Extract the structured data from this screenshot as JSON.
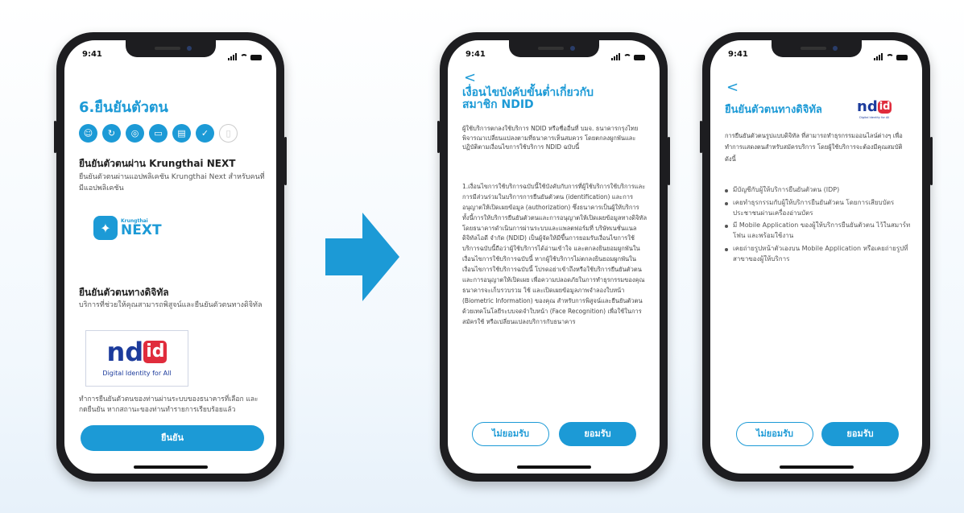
{
  "phone1": {
    "time": "9:41",
    "title": "6.ยืนยันตัวตน",
    "step_icons": [
      "user-icon",
      "refresh-icon",
      "fingerprint-icon",
      "card-icon",
      "document-icon",
      "document-check-icon",
      "document-outline-icon"
    ],
    "section1_heading": "ยืนยันตัวตนผ่าน Krungthai NEXT",
    "section1_desc": "ยืนยันตัวตนผ่านแอปพลิเคชัน Krungthai Next สำหรับคนที่มีแอปพลิเคชัน",
    "next_logo_small": "Krungthai",
    "next_logo_big": "NEXT",
    "section2_heading": "ยืนยันตัวตนทางดิจิทัล",
    "section2_desc": "บริการที่ช่วยให้คุณสามารถพิสูจน์และยืนยันตัวตนทางดิจิทัล",
    "ndid_word_left": "nd",
    "ndid_word_right": "id",
    "ndid_tagline": "Digital Identity for All",
    "footer_text": "ทำการยืนยันตัวตนของท่านผ่านระบบของธนาคารที่เลือก และกดยืนยัน หากสถานะของท่านทำรายการเรียบร้อยแล้ว",
    "confirm_button": "ยืนยัน"
  },
  "arrow_color": "#1c9ad6",
  "phone2": {
    "time": "9:41",
    "back": "<",
    "title": "เงื่อนไขบังคับขั้นต่ำเกี่ยวกับสมาชิก NDID",
    "intro": "ผู้ใช้บริการตกลงใช้บริการ NDID หรือชื่ออื่นที่ บมจ. ธนาคารกรุงไทย พิจารณาเปลี่ยนแปลงตามที่ธนาคารเห็นสมควร โดยตกลงผูกพันและปฏิบัติตามเงื่อนไขการใช้บริการ NDID ฉบับนี้",
    "body": "1.เงื่อนไขการใช้บริการฉบับนี้ใช้บังคับกับการที่ผู้ใช้บริการใช้บริการและการมีส่วนร่วมในบริการการยืนยันตัวตน (identification) และการอนุญาตให้เปิดเผยข้อมูล (authorization) ซึ่งธนาคารเป็นผู้ให้บริการ ทั้งนี้การให้บริการยืนยันตัวตนและการอนุญาตให้เปิดเผยข้อมูลทางดิจิทัล โดยธนาคารดำเนินการผ่านระบบและแพลตฟอร์มที่ บริษัทเนชั่นแนลดิจิทัลไอดี จำกัด (NDID) เป็นผู้จัดให้มีขึ้นการยอมรับเงื่อนไขการใช้บริการฉบับนี้ถือว่าผู้ใช้บริการได้อ่านเข้าใจ และตกลงยินยอมผูกพันในเงื่อนไขการใช้บริการฉบับนี้ หากผู้ใช้บริการไม่ตกลงยินยอมผูกพันในเงื่อนไขการใช้บริการฉบับนี้ โปรดอย่าเข้าถึงหรือใช้บริการยืนยันตัวตนและการอนุญาตให้เปิดเผย เพื่อความปลอดภัยในการทำธุรกรรมของคุณธนาคารจะเก็บรวบรวม ใช้ และเปิดเผยข้อมูลภาพจำลองใบหน้า (Biometric Information) ของคุณ สำหรับการพิสูจน์และยืนยันตัวตนด้วยเทคโนโลยีระบบจดจำใบหน้า (Face Recognition) เพื่อใช้ในการสมัครใช้ หรือเปลี่ยนแปลงบริการกับธนาคาร",
    "decline_button": "ไม่ยอมรับ",
    "accept_button": "ยอมรับ"
  },
  "phone3": {
    "time": "9:41",
    "back": "<",
    "title": "ยืนยันตัวตนทางดิจิทัล",
    "ndid_word_left": "nd",
    "ndid_word_right": "id",
    "ndid_tagline": "Digital Identity for All",
    "intro": "การยืนยันตัวตนรูปแบบดิจิทัล ที่สามารถทำธุรกรรมออนไลน์ต่างๆ เพื่อทำการแสดงตนสำหรับสมัครบริการ โดยผู้ใช้บริการจะต้องมีคุณสมบัติดังนี้",
    "bullets": [
      "มีบัญชีกับผู้ให้บริการยืนยันตัวตน (IDP)",
      "เคยทำธุรกรรมกับผู้ให้บริการยืนยันตัวตน โดยการเสียบบัตรประชาชนผ่านเครื่องอ่านบัตร",
      "มี Mobile Application ของผู้ให้บริการยืนยันตัวตน ไว้ในสมาร์ทโฟน และพร้อมใช้งาน",
      "เคยถ่ายรูปหน้าตัวเองบน Mobile Application หรือเคยถ่ายรูปที่สาขาของผู้ให้บริการ"
    ],
    "decline_button": "ไม่ยอมรับ",
    "accept_button": "ยอมรับ"
  }
}
